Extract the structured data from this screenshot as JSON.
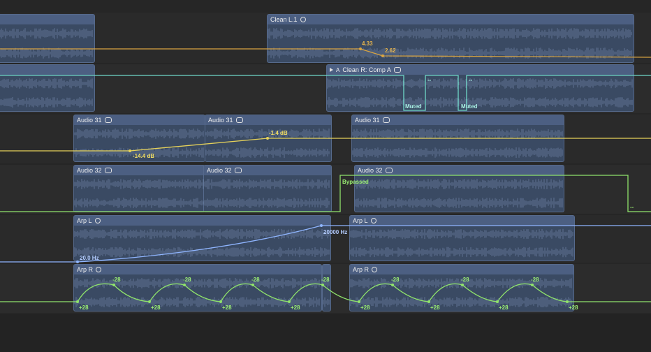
{
  "colors": {
    "orange": "#d9a441",
    "teal": "#6fd8c8",
    "yellow": "#e6d25a",
    "green": "#8fe36b",
    "blue": "#8fb5ff"
  },
  "regions": {
    "clean_l1": "Clean L.1",
    "clean_r_comp": {
      "take": "A",
      "label": "Clean R: Comp A"
    },
    "audio31": "Audio 31",
    "audio32": "Audio 32",
    "arp_l": "Arp L",
    "arp_r": "Arp R"
  },
  "automation": {
    "clean_l_start": "4.33",
    "clean_l_end": "2.62",
    "muted": "Muted",
    "dash": "--",
    "audio31_start": "-14.4 dB",
    "audio31_end": "-1.4 dB",
    "bypassed": "Bypassed",
    "arp_l_start": "20.0 Hz",
    "arp_l_end": "20000 Hz",
    "pan_top": "-28",
    "pan_bottom": "+28"
  }
}
